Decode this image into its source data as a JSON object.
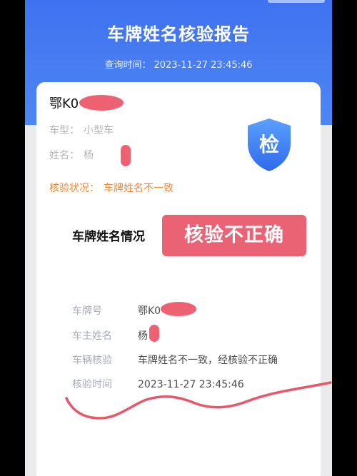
{
  "header": {
    "title": "车牌姓名核验报告",
    "query_time_label": "查询时间：",
    "query_time_value": "2023-11-27 23:45:46"
  },
  "summary": {
    "plate": "鄂K0",
    "vehicle_type_label": "车型：",
    "vehicle_type_value": "小型车",
    "name_label": "姓名：",
    "name_value": "杨",
    "status_label": "核验状况：",
    "status_value": "车牌姓名不一致",
    "badge_char": "检"
  },
  "result": {
    "label": "车牌姓名情况",
    "verdict": "核验不正确"
  },
  "details": [
    {
      "key": "车牌号",
      "value": "鄂K0"
    },
    {
      "key": "车主姓名",
      "value": "杨"
    },
    {
      "key": "车辆核验",
      "value": "车牌姓名不一致，经核验不正确"
    },
    {
      "key": "核验时间",
      "value": "2023-11-27 23:45:46"
    }
  ],
  "colors": {
    "header_blue": "#3f72f0",
    "status_orange": "#f08a3c",
    "verdict_red": "#ea6375",
    "annotation_red": "#e8566a"
  }
}
